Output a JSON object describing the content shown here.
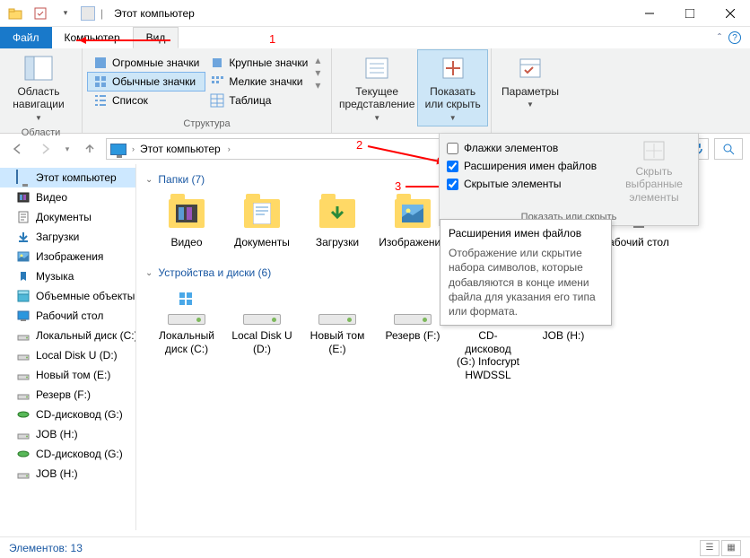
{
  "title": "Этот компьютер",
  "tabs": {
    "file": "Файл",
    "computer": "Компьютер",
    "view": "Вид"
  },
  "ribbon": {
    "nav_panel": "Область навигации",
    "nav_footer": "Области",
    "layout": {
      "huge": "Огромные значки",
      "large": "Крупные значки",
      "normal": "Обычные значки",
      "small": "Мелкие значки",
      "list": "Список",
      "table": "Таблица"
    },
    "layout_footer": "Структура",
    "current_view": "Текущее представление",
    "show_hide": "Показать или скрыть",
    "params": "Параметры"
  },
  "dropdown": {
    "flags": "Флажки элементов",
    "ext": "Расширения имен файлов",
    "hidden": "Скрытые элементы",
    "hide_selected": "Скрыть выбранные элементы",
    "footer": "Показать или скрыть"
  },
  "addr": {
    "this_pc": "Этот компьютер"
  },
  "sidebar": [
    "Этот компьютер",
    "Видео",
    "Документы",
    "Загрузки",
    "Изображения",
    "Музыка",
    "Объемные объекты",
    "Рабочий стол",
    "Локальный диск (C:)",
    "Local Disk U (D:)",
    "Новый том (E:)",
    "Резерв (F:)",
    "CD-дисковод (G:)",
    "JOB (H:)",
    "CD-дисковод (G:)",
    "JOB (H:)"
  ],
  "sections": {
    "folders": "Папки (7)",
    "devices": "Устройства и диски (6)"
  },
  "folders": [
    "Видео",
    "Документы",
    "Загрузки",
    "Изображения",
    "",
    "",
    "абочий стол"
  ],
  "drives": [
    "Локальный диск (C:)",
    "Local Disk U (D:)",
    "Новый том (E:)",
    "Резерв (F:)",
    "CD-дисковод (G:) Infocrypt HWDSSL",
    "JOB (H:)"
  ],
  "tooltip": {
    "title": "Расширения имен файлов",
    "body": "Отображение или скрытие набора символов, которые добавляются в конце имени файла для указания его типа или формата."
  },
  "status": "Элементов: 13",
  "anno": {
    "n1": "1",
    "n2": "2",
    "n3": "3"
  }
}
